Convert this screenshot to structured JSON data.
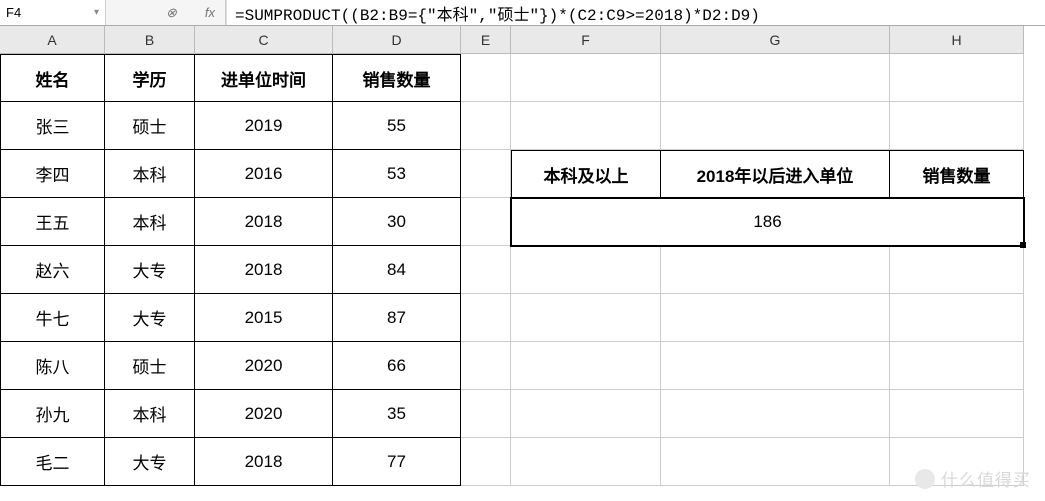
{
  "nameBox": "F4",
  "formulaIcons": {
    "cancel": "⊗",
    "fx": "fx"
  },
  "formula": "=SUMPRODUCT((B2:B9={\"本科\",\"硕士\"})*(C2:C9>=2018)*D2:D9)",
  "columns": [
    "A",
    "B",
    "C",
    "D",
    "E",
    "F",
    "G",
    "H"
  ],
  "headers": {
    "A": "姓名",
    "B": "学历",
    "C": "进单位时间",
    "D": "销售数量"
  },
  "rows": [
    {
      "name": "张三",
      "edu": "硕士",
      "year": "2019",
      "qty": "55"
    },
    {
      "name": "李四",
      "edu": "本科",
      "year": "2016",
      "qty": "53"
    },
    {
      "name": "王五",
      "edu": "本科",
      "year": "2018",
      "qty": "30"
    },
    {
      "name": "赵六",
      "edu": "大专",
      "year": "2018",
      "qty": "84"
    },
    {
      "name": "牛七",
      "edu": "大专",
      "year": "2015",
      "qty": "87"
    },
    {
      "name": "陈八",
      "edu": "硕士",
      "year": "2020",
      "qty": "66"
    },
    {
      "name": "孙九",
      "edu": "本科",
      "year": "2020",
      "qty": "35"
    },
    {
      "name": "毛二",
      "edu": "大专",
      "year": "2018",
      "qty": "77"
    }
  ],
  "summary": {
    "F": "本科及以上",
    "G": "2018年以后进入单位",
    "H": "销售数量",
    "result": "186"
  },
  "watermark": "什么值得买",
  "chart_data": {
    "type": "table",
    "columns": [
      "姓名",
      "学历",
      "进单位时间",
      "销售数量"
    ],
    "data": [
      [
        "张三",
        "硕士",
        2019,
        55
      ],
      [
        "李四",
        "本科",
        2016,
        53
      ],
      [
        "王五",
        "本科",
        2018,
        30
      ],
      [
        "赵六",
        "大专",
        2018,
        84
      ],
      [
        "牛七",
        "大专",
        2015,
        87
      ],
      [
        "陈八",
        "硕士",
        2020,
        66
      ],
      [
        "孙九",
        "本科",
        2020,
        35
      ],
      [
        "毛二",
        "大专",
        2018,
        77
      ]
    ],
    "summary": {
      "criteria": [
        "本科及以上",
        "2018年以后进入单位"
      ],
      "metric": "销售数量",
      "result": 186
    }
  }
}
